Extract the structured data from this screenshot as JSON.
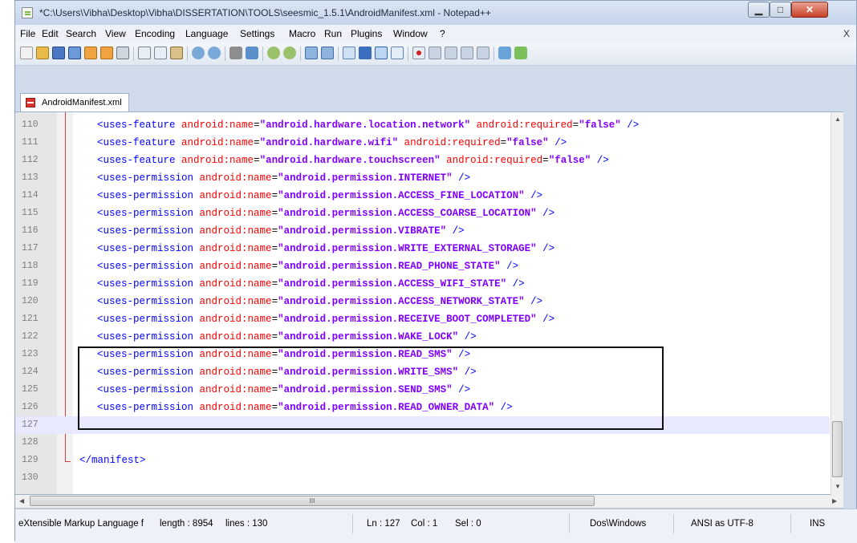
{
  "window": {
    "title": "*C:\\Users\\Vibha\\Desktop\\Vibha\\DISSERTATION\\TOOLS\\seesmic_1.5.1\\AndroidManifest.xml - Notepad++",
    "minimize": "▁",
    "maximize": "□",
    "close": "✕"
  },
  "menu": {
    "items": [
      "File",
      "Edit",
      "Search",
      "View",
      "Encoding",
      "Language",
      "Settings",
      "Macro",
      "Run",
      "Plugins",
      "Window",
      "?"
    ],
    "close": "X"
  },
  "toolbar": {
    "icons": [
      "new-file-icon",
      "open-file-icon",
      "save-icon",
      "save-all-icon",
      "close-icon",
      "close-all-icon",
      "print-icon",
      "cut-icon",
      "copy-icon",
      "paste-icon",
      "undo-icon",
      "redo-icon",
      "find-icon",
      "replace-icon",
      "zoom-in-icon",
      "zoom-out-icon",
      "sync-vertical-icon",
      "sync-horizontal-icon",
      "word-wrap-icon",
      "show-all-chars-icon",
      "indent-guide-icon",
      "user-lang-icon",
      "record-macro-icon",
      "stop-record-icon",
      "play-macro-icon",
      "play-multiple-icon",
      "save-macro-icon",
      "launch-browser-icon",
      "spellcheck-icon"
    ]
  },
  "tab": {
    "label": "AndroidManifest.xml"
  },
  "editor": {
    "lines": [
      {
        "num": "110",
        "type": "feature",
        "tag": "<uses-feature",
        "attr": "android:name",
        "value": "\"android.hardware.location.network\"",
        "attr2": "android:required",
        "value2": "\"false\"",
        "close": "/>"
      },
      {
        "num": "111",
        "type": "feature",
        "tag": "<uses-feature",
        "attr": "android:name",
        "value": "\"android.hardware.wifi\"",
        "attr2": "android:required",
        "value2": "\"false\"",
        "close": "/>"
      },
      {
        "num": "112",
        "type": "feature",
        "tag": "<uses-feature",
        "attr": "android:name",
        "value": "\"android.hardware.touchscreen\"",
        "attr2": "android:required",
        "value2": "\"false\"",
        "close": "/>"
      },
      {
        "num": "113",
        "type": "perm",
        "tag": "<uses-permission",
        "attr": "android:name",
        "value": "\"android.permission.INTERNET\"",
        "close": "/>"
      },
      {
        "num": "114",
        "type": "perm",
        "tag": "<uses-permission",
        "attr": "android:name",
        "value": "\"android.permission.ACCESS_FINE_LOCATION\"",
        "close": "/>"
      },
      {
        "num": "115",
        "type": "perm",
        "tag": "<uses-permission",
        "attr": "android:name",
        "value": "\"android.permission.ACCESS_COARSE_LOCATION\"",
        "close": "/>"
      },
      {
        "num": "116",
        "type": "perm",
        "tag": "<uses-permission",
        "attr": "android:name",
        "value": "\"android.permission.VIBRATE\"",
        "close": "/>"
      },
      {
        "num": "117",
        "type": "perm",
        "tag": "<uses-permission",
        "attr": "android:name",
        "value": "\"android.permission.WRITE_EXTERNAL_STORAGE\"",
        "close": "/>"
      },
      {
        "num": "118",
        "type": "perm",
        "tag": "<uses-permission",
        "attr": "android:name",
        "value": "\"android.permission.READ_PHONE_STATE\"",
        "close": "/>"
      },
      {
        "num": "119",
        "type": "perm",
        "tag": "<uses-permission",
        "attr": "android:name",
        "value": "\"android.permission.ACCESS_WIFI_STATE\"",
        "close": "/>"
      },
      {
        "num": "120",
        "type": "perm",
        "tag": "<uses-permission",
        "attr": "android:name",
        "value": "\"android.permission.ACCESS_NETWORK_STATE\"",
        "close": "/>"
      },
      {
        "num": "121",
        "type": "perm",
        "tag": "<uses-permission",
        "attr": "android:name",
        "value": "\"android.permission.RECEIVE_BOOT_COMPLETED\"",
        "close": "/>"
      },
      {
        "num": "122",
        "type": "perm",
        "tag": "<uses-permission",
        "attr": "android:name",
        "value": "\"android.permission.WAKE_LOCK\"",
        "close": "/>"
      },
      {
        "num": "123",
        "type": "perm",
        "tag": "<uses-permission",
        "attr": "android:name",
        "value": "\"android.permission.READ_SMS\"",
        "close": "/>"
      },
      {
        "num": "124",
        "type": "perm",
        "tag": "<uses-permission",
        "attr": "android:name",
        "value": "\"android.permission.WRITE_SMS\"",
        "close": "/>"
      },
      {
        "num": "125",
        "type": "perm",
        "tag": "<uses-permission",
        "attr": "android:name",
        "value": "\"android.permission.SEND_SMS\"",
        "close": "/>"
      },
      {
        "num": "126",
        "type": "perm",
        "tag": "<uses-permission",
        "attr": "android:name",
        "value": "\"android.permission.READ_OWNER_DATA\"",
        "close": "/>"
      },
      {
        "num": "127",
        "type": "empty",
        "current": true
      },
      {
        "num": "128",
        "type": "empty"
      },
      {
        "num": "129",
        "type": "end",
        "tag": "</manifest>"
      },
      {
        "num": "130",
        "type": "empty"
      }
    ],
    "hscroll_thumb": "III"
  },
  "status": {
    "filetype": "eXtensible Markup Language f",
    "length": "length : 8954",
    "lines": "lines : 130",
    "ln": "Ln : 127",
    "col": "Col : 1",
    "sel": "Sel : 0",
    "eol": "Dos\\Windows",
    "encoding": "ANSI as UTF-8",
    "mode": "INS"
  },
  "colors": {
    "tag": "#0000ff",
    "attr": "#ff0000",
    "value": "#8000ff",
    "current_line": "#e8e8ff"
  }
}
